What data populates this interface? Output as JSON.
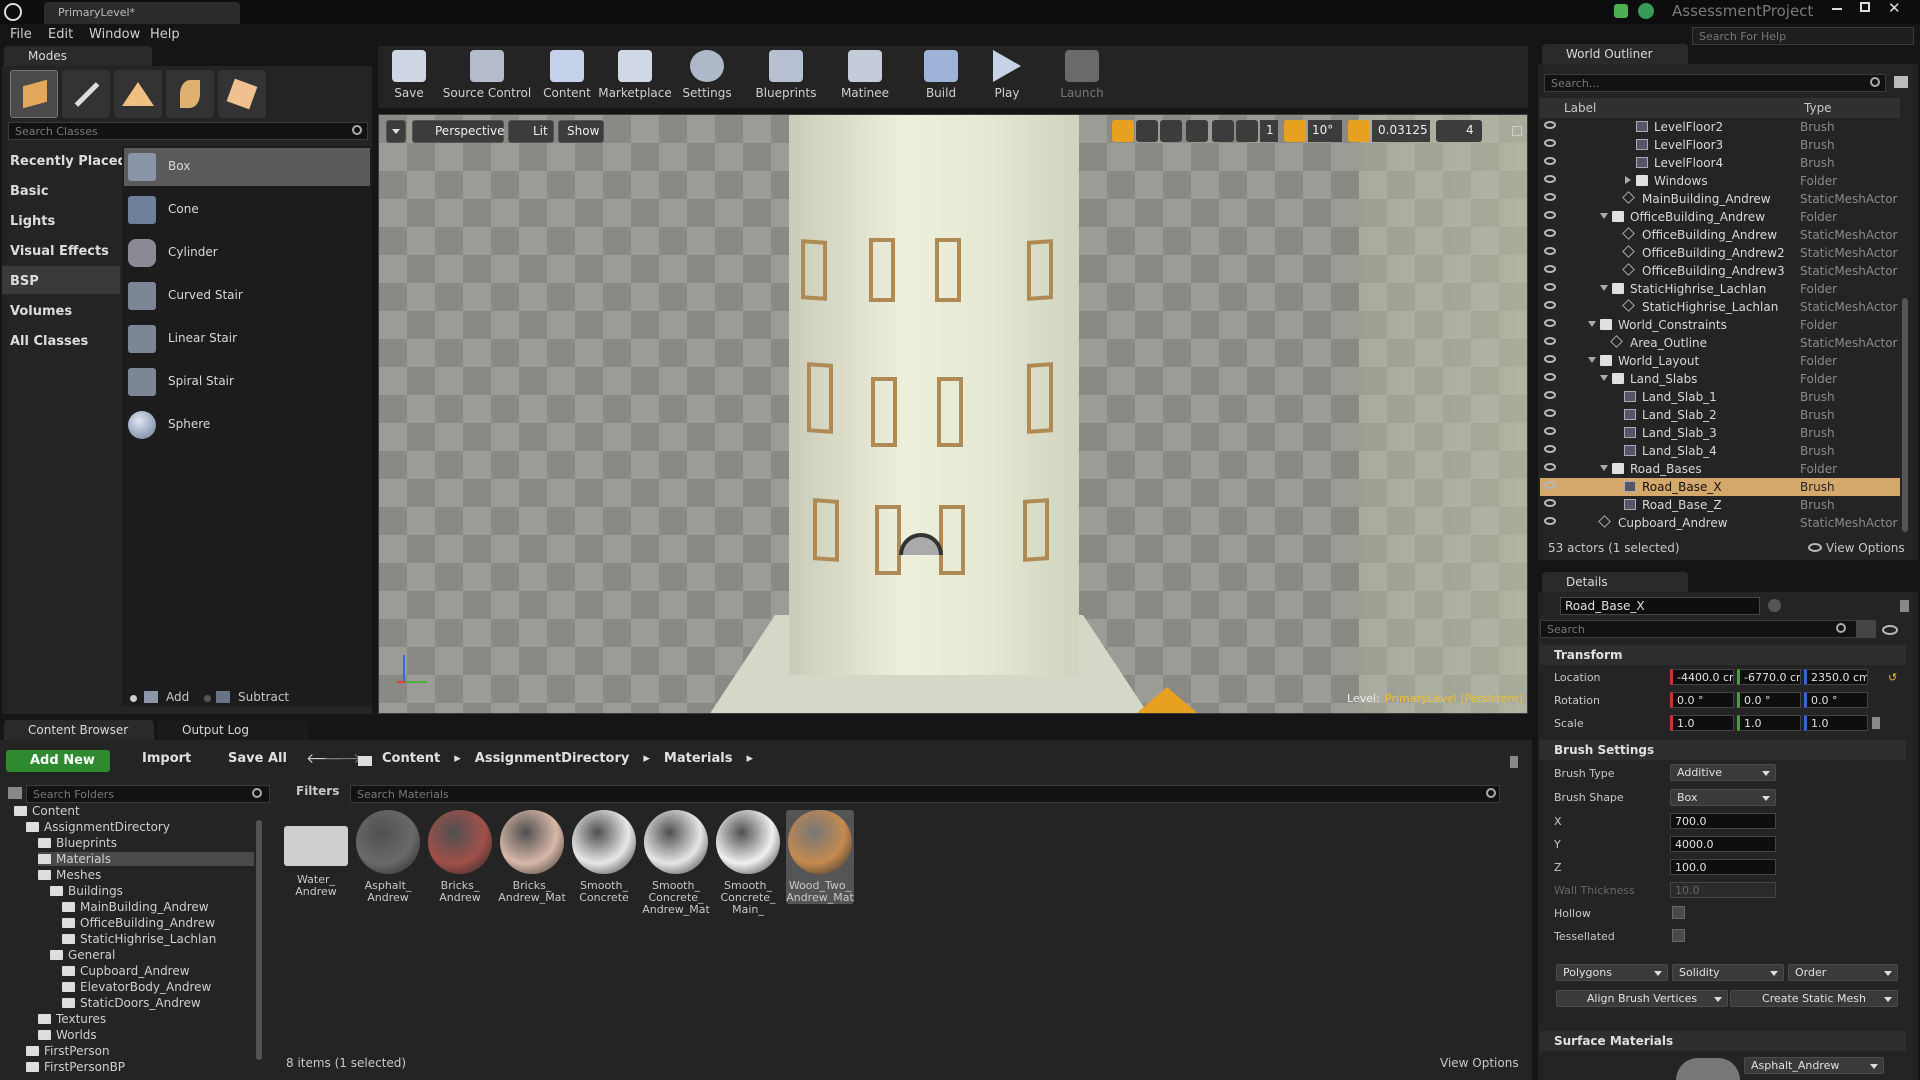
{
  "window": {
    "tab_title": "PrimaryLevel*",
    "project_name": "AssessmentProject",
    "help_search_placeholder": "Search For Help"
  },
  "menu": [
    "File",
    "Edit",
    "Window",
    "Help"
  ],
  "modes": {
    "tab_label": "Modes",
    "search_placeholder": "Search Classes",
    "categories": [
      "Recently Placed",
      "Basic",
      "Lights",
      "Visual Effects",
      "BSP",
      "Volumes",
      "All Classes"
    ],
    "selected_category": "BSP",
    "items": [
      "Box",
      "Cone",
      "Cylinder",
      "Curved Stair",
      "Linear Stair",
      "Spiral Stair",
      "Sphere"
    ],
    "selected_item": "Box",
    "add_label": "Add",
    "subtract_label": "Subtract"
  },
  "toolbar": [
    "Save",
    "Source Control",
    "Content",
    "Marketplace",
    "Settings",
    "Blueprints",
    "Matinee",
    "Build",
    "Play",
    "Launch"
  ],
  "viewport": {
    "perspective_label": "Perspective",
    "lit_label": "Lit",
    "show_label": "Show",
    "rot_snap": "10°",
    "scale_snap": "0.03125",
    "cam_speed": "4",
    "level_prefix": "Level:",
    "level_name": "PrimaryLevel (Persistent)",
    "grid_snap": "1"
  },
  "outliner": {
    "tab_label": "World Outliner",
    "search_placeholder": "Search...",
    "col_label": "Label",
    "col_type": "Type",
    "rows": [
      {
        "label": "LevelFloor2",
        "type": "Brush",
        "indent": 4,
        "icon": "brush"
      },
      {
        "label": "LevelFloor3",
        "type": "Brush",
        "indent": 4,
        "icon": "brush"
      },
      {
        "label": "LevelFloor4",
        "type": "Brush",
        "indent": 4,
        "icon": "brush"
      },
      {
        "label": "Windows",
        "type": "Folder",
        "indent": 4,
        "icon": "folder",
        "expander": "collapsed"
      },
      {
        "label": "MainBuilding_Andrew",
        "type": "StaticMeshActor",
        "indent": 3,
        "icon": "mesh"
      },
      {
        "label": "OfficeBuilding_Andrew",
        "type": "Folder",
        "indent": 2,
        "icon": "folder",
        "expander": "expanded"
      },
      {
        "label": "OfficeBuilding_Andrew",
        "type": "StaticMeshActor",
        "indent": 3,
        "icon": "mesh"
      },
      {
        "label": "OfficeBuilding_Andrew2",
        "type": "StaticMeshActor",
        "indent": 3,
        "icon": "mesh"
      },
      {
        "label": "OfficeBuilding_Andrew3",
        "type": "StaticMeshActor",
        "indent": 3,
        "icon": "mesh"
      },
      {
        "label": "StaticHighrise_Lachlan",
        "type": "Folder",
        "indent": 2,
        "icon": "folder",
        "expander": "expanded"
      },
      {
        "label": "StaticHighrise_Lachlan",
        "type": "StaticMeshActor",
        "indent": 3,
        "icon": "mesh"
      },
      {
        "label": "World_Constraints",
        "type": "Folder",
        "indent": 1,
        "icon": "folder",
        "expander": "expanded"
      },
      {
        "label": "Area_Outline",
        "type": "StaticMeshActor",
        "indent": 2,
        "icon": "mesh"
      },
      {
        "label": "World_Layout",
        "type": "Folder",
        "indent": 1,
        "icon": "folder",
        "expander": "expanded"
      },
      {
        "label": "Land_Slabs",
        "type": "Folder",
        "indent": 2,
        "icon": "folder",
        "expander": "expanded"
      },
      {
        "label": "Land_Slab_1",
        "type": "Brush",
        "indent": 3,
        "icon": "brush"
      },
      {
        "label": "Land_Slab_2",
        "type": "Brush",
        "indent": 3,
        "icon": "brush"
      },
      {
        "label": "Land_Slab_3",
        "type": "Brush",
        "indent": 3,
        "icon": "brush"
      },
      {
        "label": "Land_Slab_4",
        "type": "Brush",
        "indent": 3,
        "icon": "brush"
      },
      {
        "label": "Road_Bases",
        "type": "Folder",
        "indent": 2,
        "icon": "folder",
        "expander": "expanded"
      },
      {
        "label": "Road_Base_X",
        "type": "Brush",
        "indent": 3,
        "icon": "brush",
        "selected": true
      },
      {
        "label": "Road_Base_Z",
        "type": "Brush",
        "indent": 3,
        "icon": "brush"
      },
      {
        "label": "Cupboard_Andrew",
        "type": "StaticMeshActor",
        "indent": 1,
        "icon": "mesh"
      }
    ],
    "status": "53 actors (1 selected)",
    "view_options": "View Options"
  },
  "details": {
    "tab_label": "Details",
    "actor_name": "Road_Base_X",
    "search_placeholder": "Search",
    "transform_header": "Transform",
    "location_label": "Location",
    "rotation_label": "Rotation",
    "scale_label": "Scale",
    "location": [
      "-4400.0 cm",
      "-6770.0 cm",
      "2350.0 cm"
    ],
    "rotation": [
      "0.0 °",
      "0.0 °",
      "0.0 °"
    ],
    "scale": [
      "1.0",
      "1.0",
      "1.0"
    ],
    "brush_header": "Brush Settings",
    "brush_type_label": "Brush Type",
    "brush_type": "Additive",
    "brush_shape_label": "Brush Shape",
    "brush_shape": "Box",
    "x_label": "X",
    "x": "700.0",
    "y_label": "Y",
    "y": "4000.0",
    "z_label": "Z",
    "z": "100.0",
    "wall_label": "Wall Thickness",
    "wall": "10.0",
    "hollow_label": "Hollow",
    "tess_label": "Tessellated",
    "polygons": "Polygons",
    "solidity": "Solidity",
    "order": "Order",
    "align_btn": "Align Brush Vertices",
    "create_btn": "Create Static Mesh",
    "surface_header": "Surface Materials",
    "surface_material": "Asphalt_Andrew"
  },
  "content_browser": {
    "tab_label": "Content Browser",
    "output_tab_label": "Output Log",
    "add_new": "Add New",
    "import": "Import",
    "save_all": "Save All",
    "path": [
      "Content",
      "AssignmentDirectory",
      "Materials"
    ],
    "folder_search_placeholder": "Search Folders",
    "filters": "Filters",
    "asset_search_placeholder": "Search Materials",
    "tree": [
      {
        "label": "Content",
        "indent": 0
      },
      {
        "label": "AssignmentDirectory",
        "indent": 1
      },
      {
        "label": "Blueprints",
        "indent": 2
      },
      {
        "label": "Materials",
        "indent": 2,
        "selected": true
      },
      {
        "label": "Meshes",
        "indent": 2
      },
      {
        "label": "Buildings",
        "indent": 3
      },
      {
        "label": "MainBuilding_Andrew",
        "indent": 4
      },
      {
        "label": "OfficeBuilding_Andrew",
        "indent": 4
      },
      {
        "label": "StaticHighrise_Lachlan",
        "indent": 4
      },
      {
        "label": "General",
        "indent": 3
      },
      {
        "label": "Cupboard_Andrew",
        "indent": 4
      },
      {
        "label": "ElevatorBody_Andrew",
        "indent": 4
      },
      {
        "label": "StaticDoors_Andrew",
        "indent": 4
      },
      {
        "label": "Textures",
        "indent": 2
      },
      {
        "label": "Worlds",
        "indent": 2
      },
      {
        "label": "FirstPerson",
        "indent": 1
      },
      {
        "label": "FirstPersonBP",
        "indent": 1
      }
    ],
    "assets": [
      {
        "name": "Water_\nAndrew",
        "color": "folder"
      },
      {
        "name": "Asphalt_\nAndrew",
        "color": "#6a6a6a"
      },
      {
        "name": "Bricks_\nAndrew",
        "color": "#a0504a"
      },
      {
        "name": "Bricks_\nAndrew_Mat",
        "color": "#d8b8a8"
      },
      {
        "name": "Smooth_\nConcrete",
        "color": "#e8e8e8"
      },
      {
        "name": "Smooth_\nConcrete_\nAndrew_Mat",
        "color": "#e6e6e6"
      },
      {
        "name": "Smooth_\nConcrete_\nMain_",
        "color": "#f0f0f0"
      },
      {
        "name": "Wood_Two_\nAndrew_Mat",
        "color": "#c48a50",
        "selected": true
      }
    ],
    "status": "8 items (1 selected)",
    "view_options": "View Options"
  }
}
